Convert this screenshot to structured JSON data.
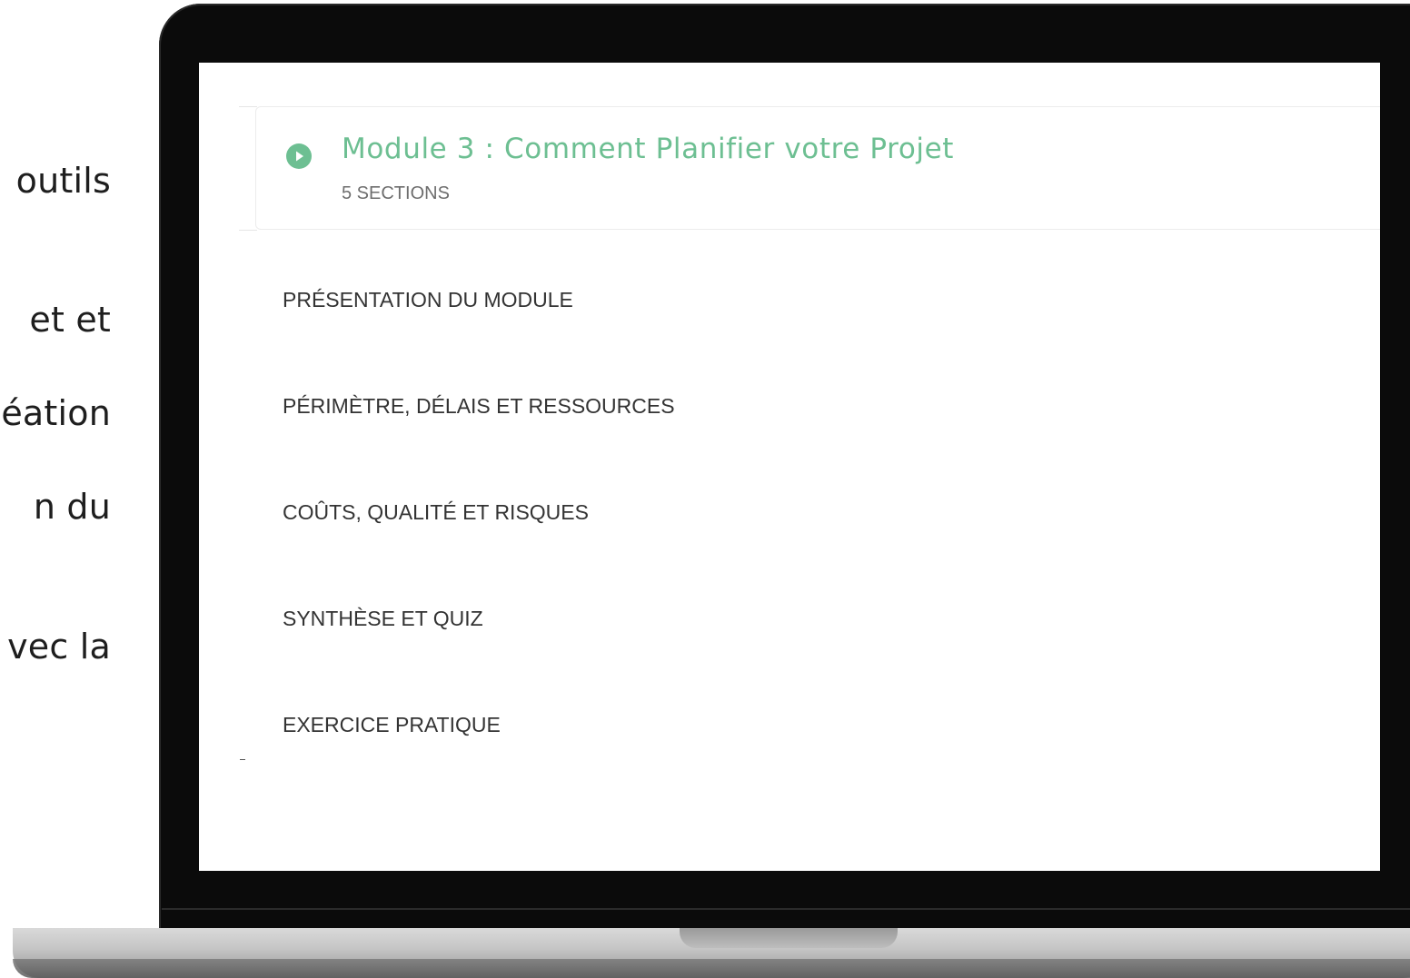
{
  "side_text": {
    "line1": "outils",
    "line2": "et   et",
    "line3": "éation",
    "line4": "n    du",
    "line5": "vec la"
  },
  "module": {
    "title": "Module 3 : Comment Planifier votre Projet",
    "sections_count": "5 SECTIONS",
    "accent_color": "#6dbf92",
    "icon": "play-circle-icon"
  },
  "sections": [
    {
      "label": "PRÉSENTATION DU MODULE"
    },
    {
      "label": "PÉRIMÈTRE, DÉLAIS ET RESSOURCES"
    },
    {
      "label": "COÛTS, QUALITÉ ET RISQUES"
    },
    {
      "label": "SYNTHÈSE ET QUIZ"
    },
    {
      "label": "EXERCICE PRATIQUE"
    }
  ]
}
